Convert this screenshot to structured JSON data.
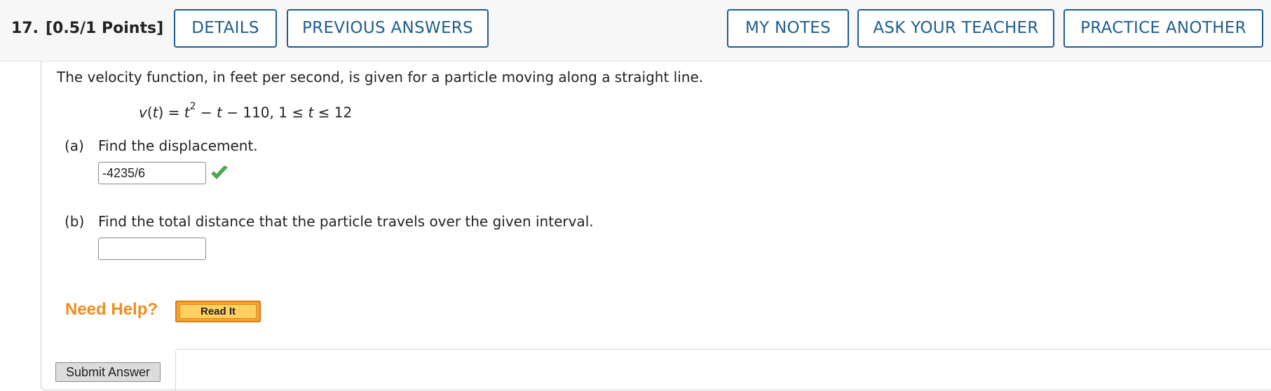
{
  "header": {
    "question_number": "17.",
    "points": "[0.5/1 Points]",
    "buttons": {
      "details": "DETAILS",
      "previous_answers": "PREVIOUS ANSWERS",
      "my_notes": "MY NOTES",
      "ask_teacher": "ASK YOUR TEACHER",
      "practice_another": "PRACTICE ANOTHER"
    }
  },
  "question": {
    "prompt": "The velocity function, in feet per second, is given for a particle moving along a straight line.",
    "formula": {
      "v": "v",
      "open": "(",
      "t": "t",
      "close": ") = ",
      "t2": "t",
      "exp": "2",
      "rest1": " − ",
      "t3": "t",
      "rest2": " − 110,  1 ≤ ",
      "t4": "t",
      "rest3": " ≤ 12"
    }
  },
  "parts": {
    "a": {
      "label": "(a)",
      "text": "Find the displacement.",
      "answer": "-4235/6",
      "status_icon": "check-icon",
      "status_color": "#4caf50"
    },
    "b": {
      "label": "(b)",
      "text": "Find the total distance that the particle travels over the given interval.",
      "answer": ""
    }
  },
  "help": {
    "need_help": "Need Help?",
    "read_it": "Read It"
  },
  "submit": {
    "label": "Submit Answer"
  },
  "colors": {
    "accent": "#1f5e8e",
    "help_orange": "#f08c1e"
  }
}
